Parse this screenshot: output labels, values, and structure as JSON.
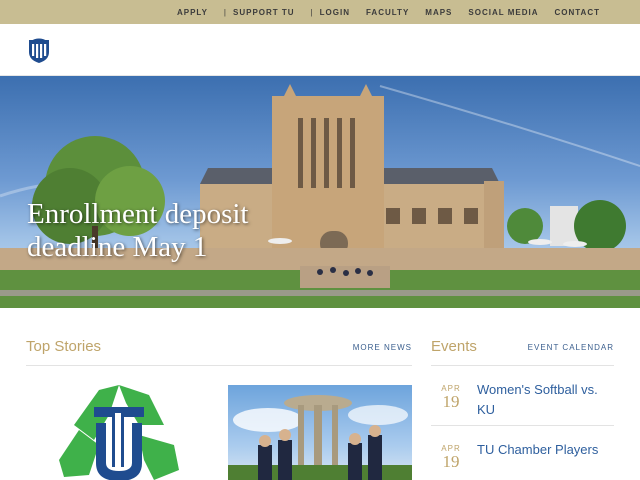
{
  "top_nav": {
    "items": [
      "APPLY",
      "SUPPORT TU",
      "LOGIN",
      "FACULTY",
      "MAPS",
      "SOCIAL MEDIA",
      "CONTACT"
    ]
  },
  "header": {
    "logo_icon": "tu-shield-logo-icon"
  },
  "hero": {
    "line1": "Enrollment deposit",
    "line2": "deadline May 1"
  },
  "stories": {
    "title": "Top Stories",
    "link": "MORE NEWS",
    "items": [
      {
        "image": "recycle-tu-logo"
      },
      {
        "image": "students-tossing-caps-photo"
      }
    ]
  },
  "events": {
    "title": "Events",
    "link": "EVENT CALENDAR",
    "items": [
      {
        "month": "APR",
        "day": "19",
        "title": "Women's Softball vs. KU"
      },
      {
        "month": "APR",
        "day": "19",
        "title": "TU Chamber Players"
      }
    ]
  },
  "colors": {
    "gold": "#c8bd92",
    "accent_gold": "#bfa46a",
    "link_blue": "#2e5f9e",
    "tu_blue": "#1f4c8f",
    "recycle_green": "#3fb14a"
  }
}
